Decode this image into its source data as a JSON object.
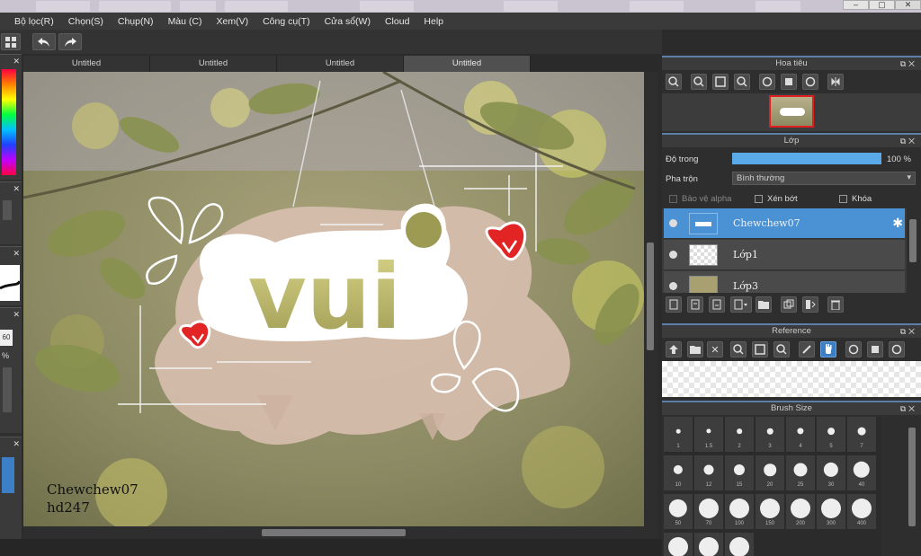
{
  "window": {
    "buttons": [
      "–",
      "▢",
      "✕"
    ]
  },
  "menu": [
    "Bộ lọc(R)",
    "Chọn(S)",
    "Chụp(N)",
    "Màu (C)",
    "Xem(V)",
    "Công cụ(T)",
    "Cửa sổ(W)",
    "Cloud",
    "Help"
  ],
  "doc_tabs": [
    {
      "label": "Untitled",
      "active": false
    },
    {
      "label": "Untitled",
      "active": false
    },
    {
      "label": "Untitled",
      "active": false
    },
    {
      "label": "Untitled",
      "active": true
    }
  ],
  "left_strip": {
    "percent_top": "60",
    "percent_sign": "%"
  },
  "canvas": {
    "artwork_text": "vui",
    "watermark_line1": "Chewchew07",
    "watermark_line2": "hd247"
  },
  "navigator": {
    "title": "Hoa tiêu"
  },
  "layers": {
    "title": "Lớp",
    "opacity_label": "Độ trong",
    "opacity_value": "100 %",
    "opacity_level": 1.0,
    "blend_label": "Pha trộn",
    "blend_value": "Bình thường",
    "protect_alpha": "Bảo vệ alpha",
    "clipping": "Xén bớt",
    "lock": "Khóa",
    "items": [
      {
        "name": "Chewchew07",
        "active": true
      },
      {
        "name": "Lớp1",
        "active": false
      },
      {
        "name": "Lớp3",
        "active": false
      }
    ]
  },
  "reference": {
    "title": "Reference"
  },
  "brush_size": {
    "title": "Brush Size",
    "sizes": [
      "1",
      "1.5",
      "2",
      "3",
      "4",
      "5",
      "7",
      "10",
      "12",
      "15",
      "20",
      "25",
      "30",
      "40",
      "50",
      "70",
      "100",
      "150",
      "200",
      "300",
      "400"
    ]
  },
  "colors": {
    "accent": "#4a92d4",
    "panel_border": "#5b7fa6"
  }
}
